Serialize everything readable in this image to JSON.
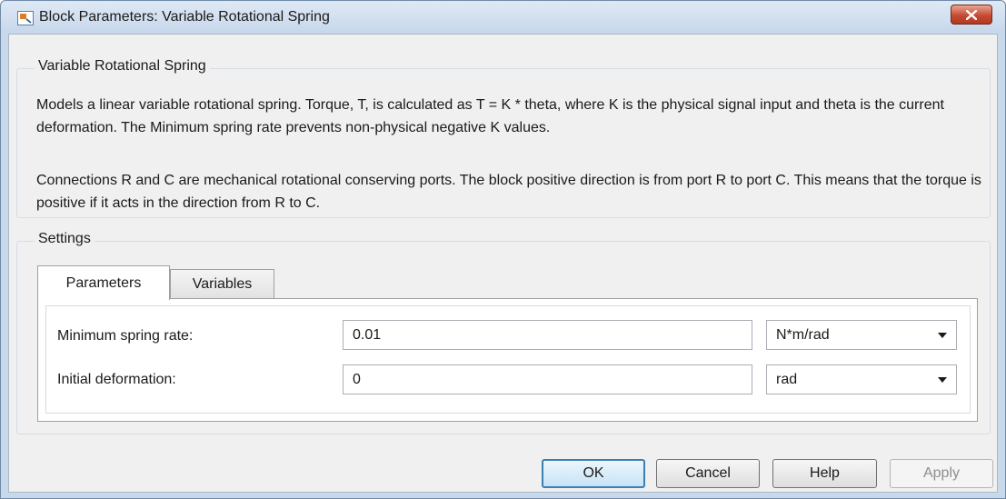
{
  "window": {
    "title": "Block Parameters: Variable Rotational Spring",
    "close_icon": "close-icon"
  },
  "description": {
    "group_title": "Variable Rotational Spring",
    "paragraph1": "Models a linear variable rotational spring. Torque, T, is calculated as T = K * theta, where K is the physical signal input and theta is the current deformation. The Minimum spring rate prevents non-physical negative K values.",
    "paragraph2": "Connections R and C are mechanical rotational conserving ports. The block positive direction is from port R to port C. This means that the torque is positive if it acts in the direction from R to C."
  },
  "settings": {
    "group_title": "Settings",
    "tabs": [
      {
        "label": "Parameters",
        "selected": true
      },
      {
        "label": "Variables",
        "selected": false
      }
    ],
    "params": [
      {
        "label": "Minimum spring rate:",
        "value": "0.01",
        "unit": "N*m/rad"
      },
      {
        "label": "Initial deformation:",
        "value": "0",
        "unit": "rad"
      }
    ]
  },
  "buttons": {
    "ok": "OK",
    "cancel": "Cancel",
    "help": "Help",
    "apply": "Apply"
  },
  "colors": {
    "titlebar": "#c6d7eb",
    "close_button": "#c74b33",
    "ok_border": "#3c7fb1"
  }
}
